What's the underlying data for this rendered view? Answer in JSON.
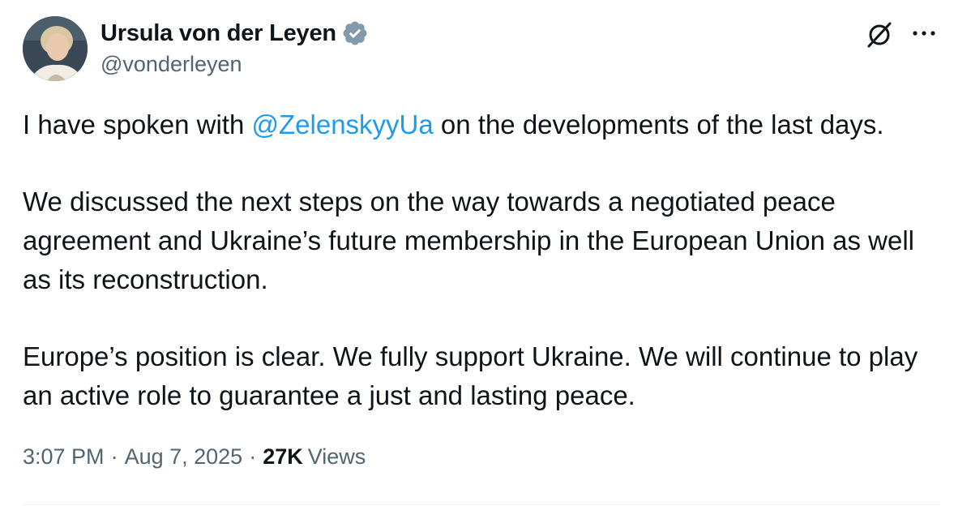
{
  "author": {
    "display_name": "Ursula von der Leyen",
    "handle": "@vonderleyen",
    "verified": true,
    "verified_badge_color": "#829aab"
  },
  "tweet": {
    "para1_pre": "I have spoken with ",
    "mention": "@ZelenskyyUa",
    "para1_post": " on the developments of the last days.",
    "para2": "We discussed the next steps on the way towards a negotiated peace agreement and Ukraine’s future membership in the European Union as well as its reconstruction.",
    "para3": "Europe’s position is clear. We fully support Ukraine. We will continue to play an active role to guarantee a just and lasting peace."
  },
  "meta": {
    "time": "3:07 PM",
    "separator": "·",
    "date": "Aug 7, 2025",
    "views_count": "27K",
    "views_label": "Views"
  },
  "icons": {
    "grok": "grok-icon",
    "more": "more-icon",
    "verified": "verified-badge-icon"
  },
  "colors": {
    "link": "#1d9bf0",
    "secondary_text": "#536471",
    "primary_text": "#0f1419"
  }
}
